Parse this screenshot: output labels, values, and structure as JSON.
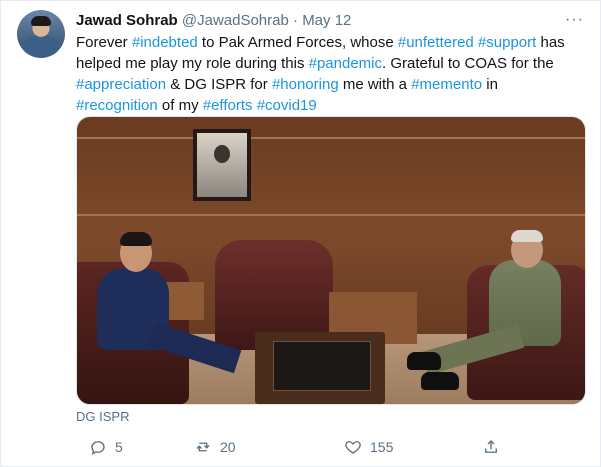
{
  "tweet": {
    "author_name": "Jawad Sohrab",
    "handle": "@JawadSohrab",
    "separator": "·",
    "date": "May 12",
    "more_label": "···",
    "text_parts": [
      {
        "text": "Forever ",
        "type": "plain"
      },
      {
        "text": "#indebted",
        "type": "hashtag"
      },
      {
        "text": " to Pak Armed Forces, whose ",
        "type": "plain"
      },
      {
        "text": "#unfettered",
        "type": "hashtag"
      },
      {
        "text": " ",
        "type": "plain"
      },
      {
        "text": "#support",
        "type": "hashtag"
      },
      {
        "text": " has helped me play my role during this ",
        "type": "plain"
      },
      {
        "text": "#pandemic",
        "type": "hashtag"
      },
      {
        "text": ". Grateful to COAS for the ",
        "type": "plain"
      },
      {
        "text": "#appreciation",
        "type": "hashtag"
      },
      {
        "text": " & DG ISPR for ",
        "type": "plain"
      },
      {
        "text": "#honoring",
        "type": "hashtag"
      },
      {
        "text": " me with a ",
        "type": "plain"
      },
      {
        "text": "#memento",
        "type": "hashtag"
      },
      {
        "text": " in ",
        "type": "plain"
      },
      {
        "text": "#recognition",
        "type": "hashtag"
      },
      {
        "text": " of my ",
        "type": "plain"
      },
      {
        "text": "#efforts",
        "type": "hashtag"
      },
      {
        "text": " ",
        "type": "plain"
      },
      {
        "text": "#covid19",
        "type": "hashtag"
      }
    ],
    "media_caption": "DG ISPR",
    "replies": "5",
    "retweets": "20",
    "likes": "155",
    "link_color": "#1b95e0"
  }
}
